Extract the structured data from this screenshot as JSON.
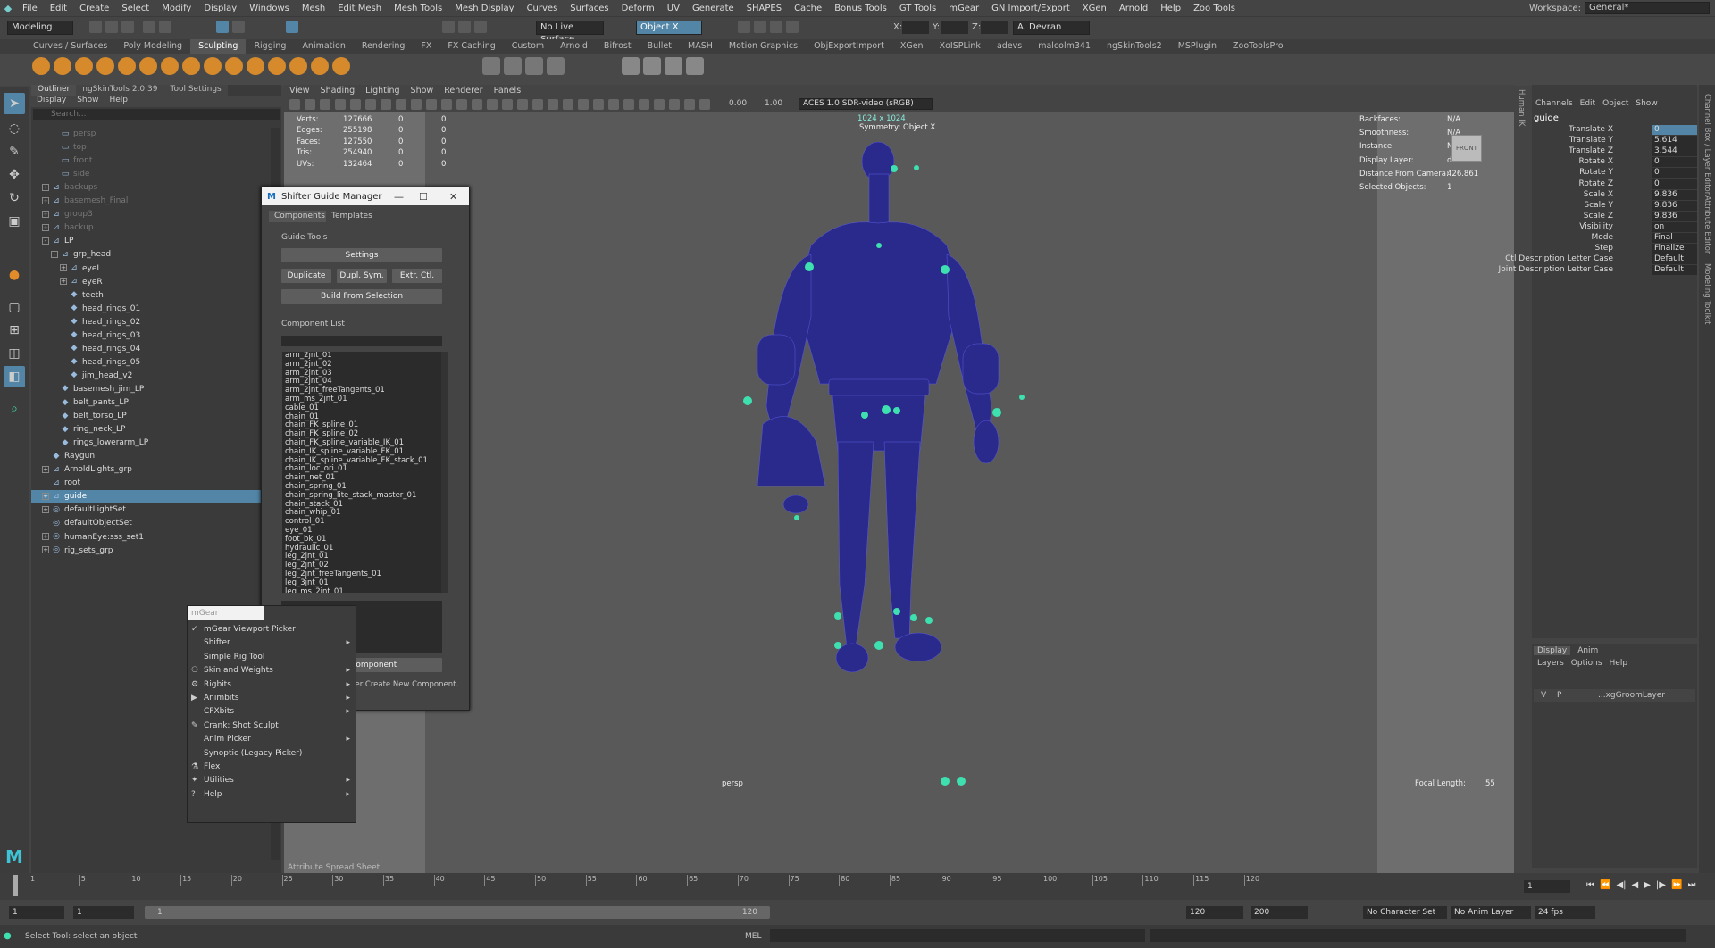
{
  "menubar": {
    "items": [
      "File",
      "Edit",
      "Create",
      "Select",
      "Modify",
      "Display",
      "Windows",
      "Mesh",
      "Edit Mesh",
      "Mesh Tools",
      "Mesh Display",
      "Curves",
      "Surfaces",
      "Deform",
      "UV",
      "Generate",
      "SHAPES",
      "Cache",
      "Bonus Tools",
      "GT Tools",
      "mGear",
      "GN Import/Export",
      "XGen",
      "Arnold",
      "Help",
      "Zoo Tools"
    ],
    "workspace_label": "Workspace:",
    "workspace_value": "General*"
  },
  "statusline": {
    "mode": "Modeling",
    "live_surface": "No Live Surface",
    "object_mode": "Object X",
    "x_label": "X:",
    "y_label": "Y:",
    "z_label": "Z:",
    "user": "A. Devran"
  },
  "shelf_tabs": [
    "Curves / Surfaces",
    "Poly Modeling",
    "Sculpting",
    "Rigging",
    "Animation",
    "Rendering",
    "FX",
    "FX Caching",
    "Custom",
    "Arnold",
    "Bifrost",
    "Bullet",
    "MASH",
    "Motion Graphics",
    "ObjExportImport",
    "XGen",
    "XoISPLink",
    "adevs",
    "malcolm341",
    "ngSkinTools2",
    "MSPlugin",
    "ZooToolsPro"
  ],
  "shelf_active": "Sculpting",
  "outliner": {
    "tabs": [
      "Outliner",
      "ngSkinTools 2.0.39",
      "Tool Settings"
    ],
    "menu": [
      "Display",
      "Show",
      "Help"
    ],
    "search_placeholder": "Search...",
    "rows": [
      {
        "label": "persp",
        "dim": true,
        "indent": 1,
        "icon": "camera"
      },
      {
        "label": "top",
        "dim": true,
        "indent": 1,
        "icon": "camera"
      },
      {
        "label": "front",
        "dim": true,
        "indent": 1,
        "icon": "camera"
      },
      {
        "label": "side",
        "dim": true,
        "indent": 1,
        "icon": "camera"
      },
      {
        "label": "backups",
        "dim": true,
        "indent": 0,
        "icon": "group",
        "exp": "+"
      },
      {
        "label": "basemesh_Final",
        "dim": true,
        "indent": 0,
        "icon": "group",
        "exp": "+"
      },
      {
        "label": "group3",
        "dim": true,
        "indent": 0,
        "icon": "group",
        "exp": "+"
      },
      {
        "label": "backup",
        "dim": true,
        "indent": 0,
        "icon": "group",
        "exp": "+"
      },
      {
        "label": "LP",
        "dim": false,
        "indent": 0,
        "icon": "group",
        "exp": "-"
      },
      {
        "label": "grp_head",
        "dim": false,
        "indent": 1,
        "icon": "group",
        "exp": "-"
      },
      {
        "label": "eyeL",
        "dim": false,
        "indent": 2,
        "icon": "group",
        "exp": "+"
      },
      {
        "label": "eyeR",
        "dim": false,
        "indent": 2,
        "icon": "group",
        "exp": "+"
      },
      {
        "label": "teeth",
        "dim": false,
        "indent": 2,
        "icon": "mesh"
      },
      {
        "label": "head_rings_01",
        "dim": false,
        "indent": 2,
        "icon": "mesh"
      },
      {
        "label": "head_rings_02",
        "dim": false,
        "indent": 2,
        "icon": "mesh"
      },
      {
        "label": "head_rings_03",
        "dim": false,
        "indent": 2,
        "icon": "mesh"
      },
      {
        "label": "head_rings_04",
        "dim": false,
        "indent": 2,
        "icon": "mesh"
      },
      {
        "label": "head_rings_05",
        "dim": false,
        "indent": 2,
        "icon": "mesh"
      },
      {
        "label": "jim_head_v2",
        "dim": false,
        "indent": 2,
        "icon": "mesh"
      },
      {
        "label": "basemesh_jim_LP",
        "dim": false,
        "indent": 1,
        "icon": "mesh"
      },
      {
        "label": "belt_pants_LP",
        "dim": false,
        "indent": 1,
        "icon": "mesh"
      },
      {
        "label": "belt_torso_LP",
        "dim": false,
        "indent": 1,
        "icon": "mesh"
      },
      {
        "label": "ring_neck_LP",
        "dim": false,
        "indent": 1,
        "icon": "mesh"
      },
      {
        "label": "rings_lowerarm_LP",
        "dim": false,
        "indent": 1,
        "icon": "mesh"
      },
      {
        "label": "Raygun",
        "dim": false,
        "indent": 0,
        "icon": "mesh"
      },
      {
        "label": "ArnoldLights_grp",
        "dim": false,
        "indent": 0,
        "icon": "group",
        "exp": "+"
      },
      {
        "label": "root",
        "dim": false,
        "indent": 0,
        "icon": "group"
      },
      {
        "label": "guide",
        "dim": false,
        "indent": 0,
        "icon": "group",
        "exp": "+",
        "selected": true
      },
      {
        "label": "defaultLightSet",
        "dim": false,
        "indent": 0,
        "icon": "set",
        "exp": "+"
      },
      {
        "label": "defaultObjectSet",
        "dim": false,
        "indent": 0,
        "icon": "set"
      },
      {
        "label": "humanEye:sss_set1",
        "dim": false,
        "indent": 0,
        "icon": "set",
        "exp": "+"
      },
      {
        "label": "rig_sets_grp",
        "dim": false,
        "indent": 0,
        "icon": "set",
        "exp": "+"
      }
    ]
  },
  "viewport": {
    "menu": [
      "View",
      "Shading",
      "Lighting",
      "Show",
      "Renderer",
      "Panels"
    ],
    "exposure": "0.00",
    "gamma": "1.00",
    "colorspace": "ACES 1.0 SDR-video (sRGB)",
    "resolution": "1024 x 1024",
    "symmetry": "Symmetry: Object X",
    "camera": "persp",
    "focal_label": "Focal Length:",
    "focal_value": "55",
    "cube_label": "FRONT",
    "hud_left": [
      {
        "k": "Verts:",
        "v": "127666",
        "a": "0",
        "b": "0"
      },
      {
        "k": "Edges:",
        "v": "255198",
        "a": "0",
        "b": "0"
      },
      {
        "k": "Faces:",
        "v": "127550",
        "a": "0",
        "b": "0"
      },
      {
        "k": "Tris:",
        "v": "254940",
        "a": "0",
        "b": "0"
      },
      {
        "k": "UVs:",
        "v": "132464",
        "a": "0",
        "b": "0"
      }
    ],
    "hud_right": [
      {
        "k": "Backfaces:",
        "v": "N/A"
      },
      {
        "k": "Smoothness:",
        "v": "N/A"
      },
      {
        "k": "Instance:",
        "v": "N/A"
      },
      {
        "k": "Display Layer:",
        "v": "default"
      },
      {
        "k": "Distance From Camera:",
        "v": "426.861"
      },
      {
        "k": "Selected Objects:",
        "v": "1"
      }
    ]
  },
  "guide_manager": {
    "title": "Shifter Guide Manager",
    "tabs": [
      "Components",
      "Templates"
    ],
    "section_tools": "Guide Tools",
    "settings": "Settings",
    "duplicate": "Duplicate",
    "dupl_sym": "Dupl. Sym.",
    "extr_ctl": "Extr. Ctl.",
    "build": "Build From Selection",
    "section_list": "Component List",
    "components": [
      "arm_2jnt_01",
      "arm_2jnt_02",
      "arm_2jnt_03",
      "arm_2jnt_04",
      "arm_2jnt_freeTangents_01",
      "arm_ms_2jnt_01",
      "cable_01",
      "chain_01",
      "chain_FK_spline_01",
      "chain_FK_spline_02",
      "chain_FK_spline_variable_IK_01",
      "chain_IK_spline_variable_FK_01",
      "chain_IK_spline_variable_FK_stack_01",
      "chain_loc_ori_01",
      "chain_net_01",
      "chain_spring_01",
      "chain_spring_lite_stack_master_01",
      "chain_stack_01",
      "chain_whip_01",
      "control_01",
      "eye_01",
      "foot_bk_01",
      "hydraulic_01",
      "leg_2jnt_01",
      "leg_2jnt_02",
      "leg_2jnt_freeTangents_01",
      "leg_3jnt_01",
      "leg_ms_2jnt_01"
    ],
    "draw": "Draw Component",
    "show_setting": "Show Setting After Create New Component."
  },
  "context_menu": {
    "header": "mGear",
    "items": [
      {
        "label": "mGear Viewport Picker",
        "icon": "check",
        "arrow": false
      },
      {
        "label": "Shifter",
        "icon": "",
        "arrow": true
      },
      {
        "label": "Simple Rig Tool",
        "icon": "",
        "arrow": false
      },
      {
        "label": "Skin and Weights",
        "icon": "skin",
        "arrow": true
      },
      {
        "label": "Rigbits",
        "icon": "rig",
        "arrow": true
      },
      {
        "label": "Animbits",
        "icon": "anim",
        "arrow": true
      },
      {
        "label": "CFXbits",
        "icon": "",
        "arrow": true
      },
      {
        "label": "Crank: Shot Sculpt",
        "icon": "crank",
        "arrow": false
      },
      {
        "label": "Anim Picker",
        "icon": "",
        "arrow": true
      },
      {
        "label": "Synoptic (Legacy Picker)",
        "icon": "",
        "arrow": false
      },
      {
        "label": "Flex",
        "icon": "flex",
        "arrow": false
      },
      {
        "label": "Utilities",
        "icon": "util",
        "arrow": true
      },
      {
        "label": "Help",
        "icon": "help",
        "arrow": true
      }
    ]
  },
  "channel_box": {
    "menu": [
      "Channels",
      "Edit",
      "Object",
      "Show"
    ],
    "object": "guide",
    "channels": [
      {
        "k": "Translate X",
        "v": "0"
      },
      {
        "k": "Translate Y",
        "v": "5.614"
      },
      {
        "k": "Translate Z",
        "v": "3.544"
      },
      {
        "k": "Rotate X",
        "v": "0"
      },
      {
        "k": "Rotate Y",
        "v": "0"
      },
      {
        "k": "Rotate Z",
        "v": "0"
      },
      {
        "k": "Scale X",
        "v": "9.836"
      },
      {
        "k": "Scale Y",
        "v": "9.836"
      },
      {
        "k": "Scale Z",
        "v": "9.836"
      },
      {
        "k": "Visibility",
        "v": "on"
      },
      {
        "k": "Mode",
        "v": "Final"
      },
      {
        "k": "Step",
        "v": "Finalize"
      },
      {
        "k": "Ctl Description Letter Case",
        "v": "Default"
      },
      {
        "k": "Joint Description Letter Case",
        "v": "Default"
      }
    ]
  },
  "layers": {
    "tabs": [
      "Display",
      "Anim"
    ],
    "menu": [
      "Layers",
      "Options",
      "Help"
    ],
    "row_v": "V",
    "row_p": "P",
    "row_name": "...xgGroomLayer"
  },
  "right_strip": [
    "Channel Box / Layer Editor",
    "Attribute Editor",
    "Modeling Toolkit",
    "Human IK"
  ],
  "timeline": {
    "ticks": [
      "1",
      "5",
      "10",
      "15",
      "20",
      "25",
      "30",
      "35",
      "40",
      "45",
      "50",
      "55",
      "60",
      "65",
      "70",
      "75",
      "80",
      "85",
      "90",
      "95",
      "100",
      "105",
      "110",
      "115",
      "120"
    ],
    "current": "1",
    "tabs_label": "Attribute Spread Sheet"
  },
  "range": {
    "start": "1",
    "start2": "1",
    "slider_start": "1",
    "slider_end": "120",
    "end": "120",
    "end2": "200",
    "char_set": "No Character Set",
    "anim_layer": "No Anim Layer",
    "fps": "24 fps"
  },
  "cmdline": {
    "help": "Select Tool: select an object",
    "lang": "MEL"
  },
  "colors": {
    "accent": "#5285a6",
    "mesh": "#2a2a8c",
    "guide": "#3fe0b0",
    "bg": "#444444"
  }
}
